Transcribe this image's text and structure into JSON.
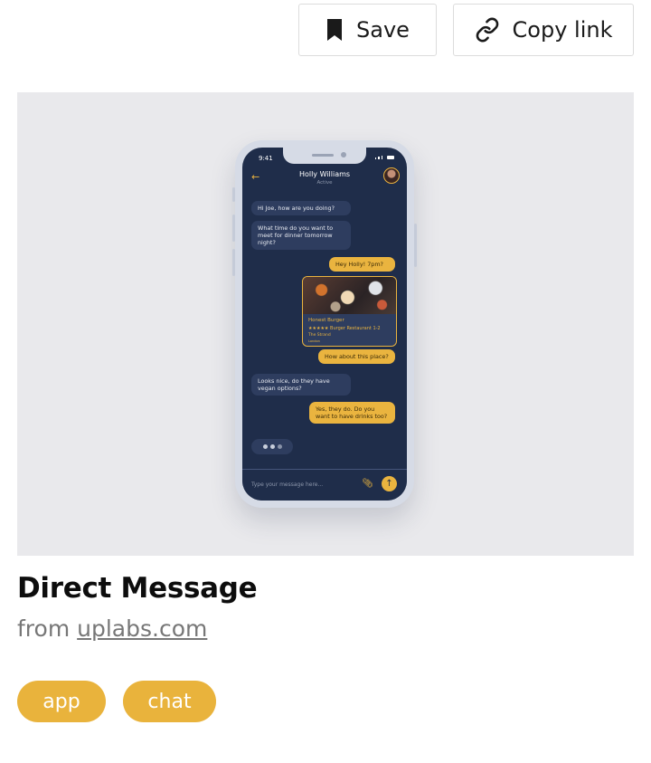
{
  "toolbar": {
    "save_label": "Save",
    "copy_link_label": "Copy link",
    "save_icon": "bookmark-icon",
    "copy_icon": "link-icon"
  },
  "preview": {
    "status_time": "9:41",
    "contact_name": "Holly Williams",
    "contact_status": "Active",
    "messages": [
      {
        "from": "them",
        "text": "Hi Joe, how are you doing?"
      },
      {
        "from": "them",
        "text": "What time do you want to meet for dinner tomorrow night?"
      },
      {
        "from": "me",
        "text": "Hey Holly! 7pm?"
      },
      {
        "from": "me",
        "text": "How about this place?"
      },
      {
        "from": "them",
        "text": "Looks nice, do they have vegan options?"
      },
      {
        "from": "me",
        "text": "Yes, they do. Do you want to have drinks too?"
      }
    ],
    "card": {
      "name": "Honest Burger",
      "rating_stars": "★★★★★",
      "meta": "Burger Restaurant 1-2",
      "address_line1": "The Strand",
      "address_line2": "London"
    },
    "compose_placeholder": "Type your message here..."
  },
  "item": {
    "title": "Direct Message",
    "source_prefix": "from",
    "source_link": "uplabs.com"
  },
  "tags": [
    "app",
    "chat"
  ],
  "colors": {
    "accent": "#e9b33c",
    "phone_screen": "#1f2d4a",
    "incoming_bubble": "#2e3d5f"
  }
}
